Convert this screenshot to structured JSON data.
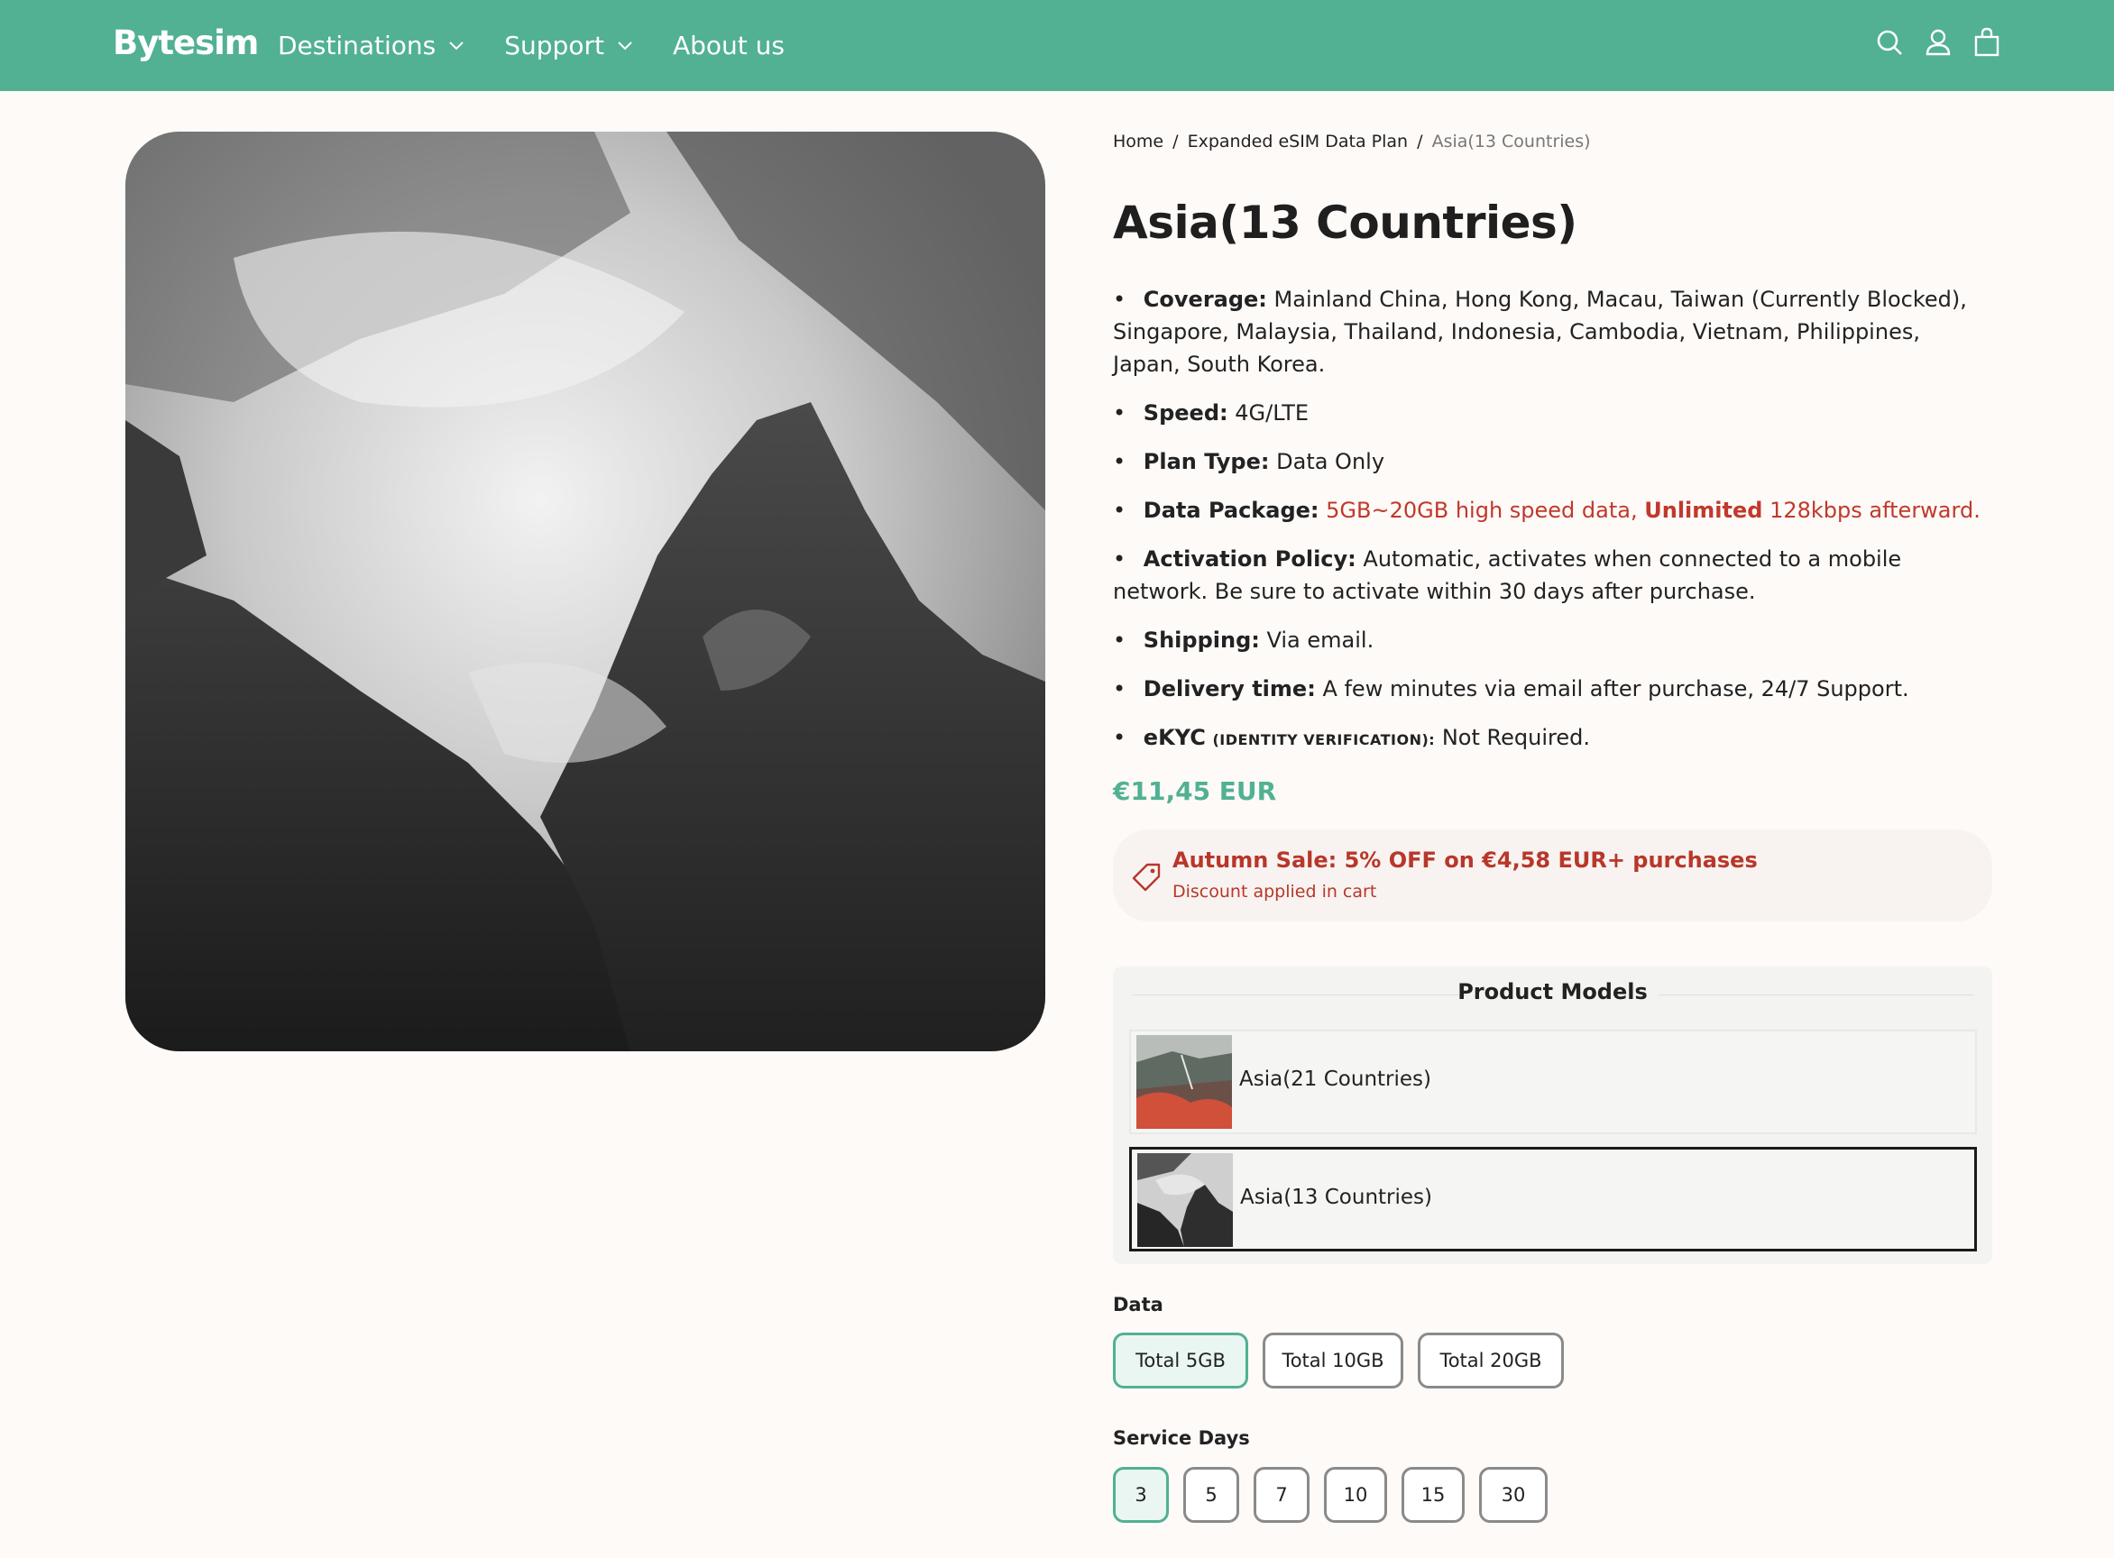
{
  "header": {
    "logo": "Bytesim",
    "nav": [
      {
        "label": "Destinations",
        "has_dropdown": true
      },
      {
        "label": "Support",
        "has_dropdown": true
      },
      {
        "label": "About us",
        "has_dropdown": false
      }
    ],
    "icons": [
      "search-icon",
      "account-icon",
      "cart-icon"
    ],
    "bg_color": "#52b093"
  },
  "breadcrumb": {
    "home": "Home",
    "sep": "/",
    "section": "Expanded eSIM Data Plan",
    "current": "Asia(13 Countries)"
  },
  "product": {
    "title": "Asia(13 Countries)",
    "features": {
      "coverage_label": "Coverage:",
      "coverage_value": "Mainland China, Hong Kong, Macau, Taiwan (Currently Blocked), Singapore, Malaysia, Thailand, Indonesia, Cambodia, Vietnam, Philippines, Japan, South Korea.",
      "speed_label": "Speed:",
      "speed_value": "4G/LTE",
      "plan_label": "Plan Type:",
      "plan_value": "Data Only",
      "data_label": "Data Package:",
      "data_value_1": "5GB~20GB high speed data,",
      "data_value_bold": "Unlimited",
      "data_value_2": "128kbps afterward.",
      "activation_label": "Activation Policy:",
      "activation_value": "Automatic, activates when connected to a mobile network. Be sure to activate within 30 days after purchase.",
      "shipping_label": "Shipping:",
      "shipping_value": "Via email.",
      "delivery_label": "Delivery time:",
      "delivery_value": "A few minutes via email after purchase, 24/7 Support.",
      "ekyc_label": "eKYC",
      "ekyc_small": "(IDENTITY VERIFICATION):",
      "ekyc_value": "Not Required."
    },
    "price": "€11,45 EUR",
    "sale": {
      "title": "Autumn Sale: 5% OFF on €4,58 EUR+ purchases",
      "subtitle": "Discount applied in cart"
    }
  },
  "models": {
    "title": "Product Models",
    "items": [
      {
        "label": "Asia(21 Countries)",
        "selected": false
      },
      {
        "label": "Asia(13 Countries)",
        "selected": true
      }
    ]
  },
  "options": {
    "data_label": "Data",
    "data_values": [
      "Total 5GB",
      "Total 10GB",
      "Total 20GB"
    ],
    "data_selected": "Total 5GB",
    "days_label": "Service Days",
    "days_values": [
      "3",
      "5",
      "7",
      "10",
      "15",
      "30"
    ],
    "days_selected": "3"
  },
  "colors": {
    "accent": "#52b093",
    "sale_red": "#b8372a"
  }
}
